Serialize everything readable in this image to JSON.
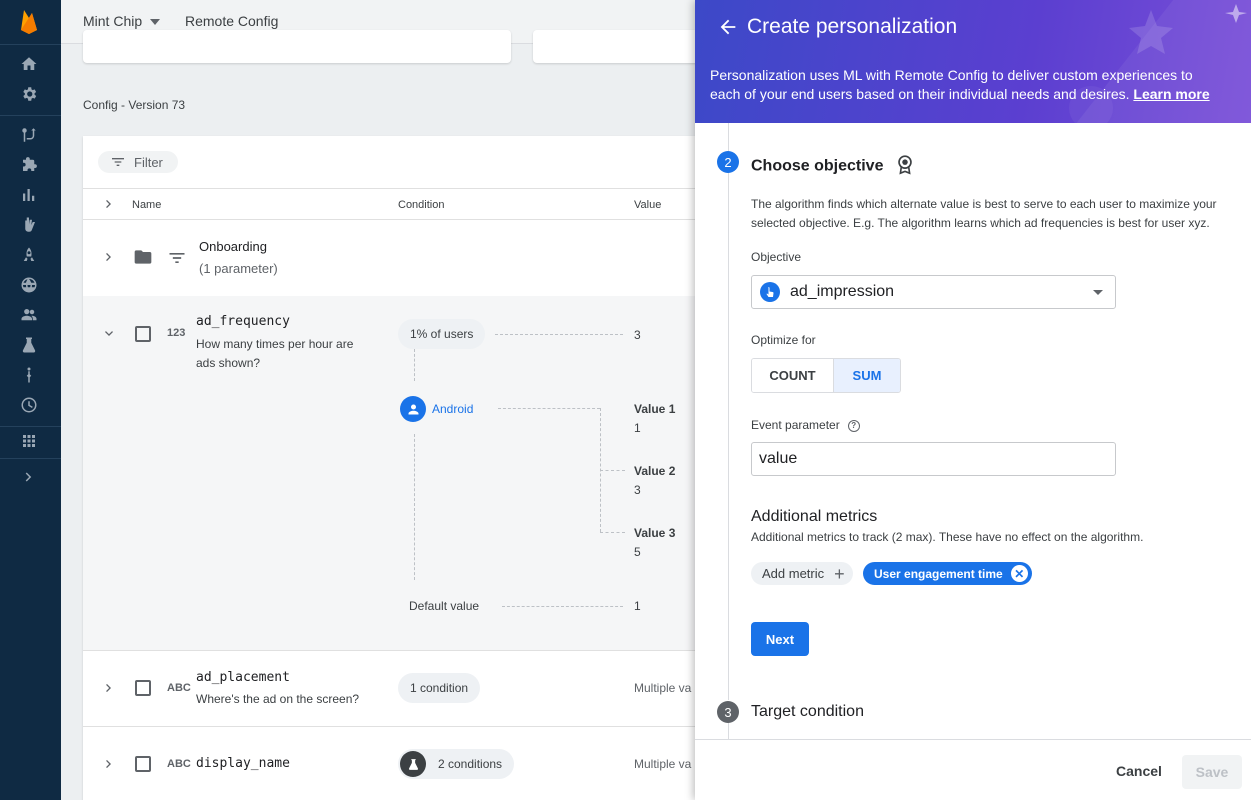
{
  "topbar": {
    "project_name": "Mint Chip",
    "product_name": "Remote Config"
  },
  "leftnav": {
    "items": [
      "home-icon",
      "gear-icon",
      "routes-icon",
      "extensions-icon",
      "analytics-icon",
      "hand-icon",
      "rocket-icon",
      "globe-icon",
      "users-icon",
      "flask-icon",
      "funnel-icon",
      "clock-icon",
      "apps-icon",
      "chevron-right-icon"
    ]
  },
  "config": {
    "version_label": "Config - Version 73",
    "filter_label": "Filter",
    "columns": {
      "name": "Name",
      "condition": "Condition",
      "value": "Value"
    },
    "group": {
      "name": "Onboarding",
      "count": "(1 parameter)"
    },
    "params": [
      {
        "key": "ad_frequency",
        "type_icon": "123",
        "description": "How many times per hour are ads shown?",
        "condition": "1% of users",
        "value": "3",
        "sub_condition": "Android",
        "variants": [
          {
            "label": "Value 1",
            "value": "1"
          },
          {
            "label": "Value 2",
            "value": "3"
          },
          {
            "label": "Value 3",
            "value": "5"
          }
        ],
        "default_label": "Default value",
        "default_value": "1"
      },
      {
        "key": "ad_placement",
        "type_icon": "ABC",
        "description": "Where's the ad on the screen?",
        "condition": "1 condition",
        "value": "Multiple va"
      },
      {
        "key": "display_name",
        "type_icon": "ABC",
        "description": "",
        "condition": "2 conditions",
        "value": "Multiple va"
      }
    ]
  },
  "panel": {
    "title": "Create personalization",
    "description": "Personalization uses ML with Remote Config to deliver custom experiences to each of your end users based on their individual needs and desires.",
    "learn_more": "Learn more",
    "step2": {
      "number": "2",
      "title": "Choose objective",
      "explanation": "The algorithm finds which alternate value is best to serve to each user to maximize your selected objective. E.g. The algorithm learns which ad frequencies is best for user xyz.",
      "objective_label": "Objective",
      "objective_value": "ad_impression",
      "optimize_label": "Optimize for",
      "optimize_options": [
        "COUNT",
        "SUM"
      ],
      "event_param_label": "Event parameter",
      "event_param_value": "value",
      "additional_title": "Additional metrics",
      "additional_desc": "Additional metrics to track (2 max). These have no effect on the algorithm.",
      "add_metric": "Add metric",
      "metric_chip": "User engagement time",
      "next": "Next"
    },
    "step3": {
      "number": "3",
      "title": "Target condition"
    },
    "cancel": "Cancel",
    "save": "Save"
  }
}
